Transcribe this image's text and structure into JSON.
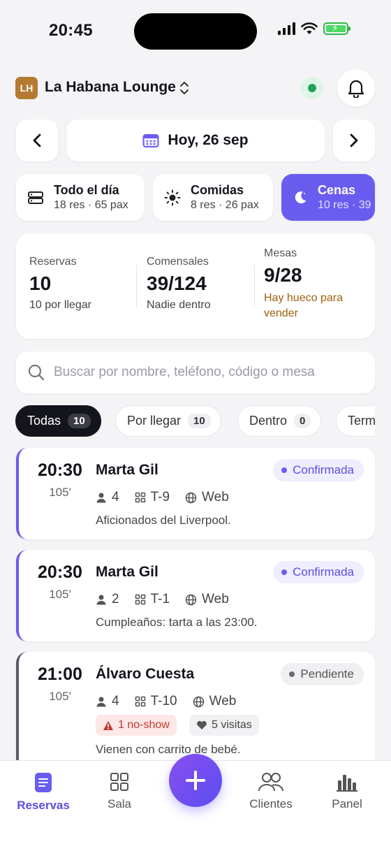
{
  "status_bar": {
    "time": "20:45"
  },
  "header": {
    "venue_initials": "LH",
    "venue_name": "La Habana Lounge"
  },
  "date_nav": {
    "label": "Hoy, 26 sep"
  },
  "services": [
    {
      "title": "Todo el día",
      "subtitle": "18 res · 65 pax",
      "icon": "list-icon"
    },
    {
      "title": "Comidas",
      "subtitle": "8 res · 26 pax",
      "icon": "sun-icon"
    },
    {
      "title": "Cenas",
      "subtitle": "10 res · 39",
      "icon": "moon-icon",
      "active": true
    }
  ],
  "stats": {
    "reservas": {
      "label": "Reservas",
      "value": "10",
      "sub": "10 por llegar"
    },
    "comensales": {
      "label": "Comensales",
      "value": "39/124",
      "sub": "Nadie dentro"
    },
    "mesas": {
      "label": "Mesas",
      "value": "9/28",
      "sub": "Hay hueco para vender"
    }
  },
  "search": {
    "placeholder": "Buscar por nombre, teléfono, código o mesa"
  },
  "filters": [
    {
      "label": "Todas",
      "count": "10",
      "active": true
    },
    {
      "label": "Por llegar",
      "count": "10"
    },
    {
      "label": "Dentro",
      "count": "0"
    },
    {
      "label": "Term"
    }
  ],
  "reservations": [
    {
      "time": "20:30",
      "duration": "105′",
      "name": "Marta Gil",
      "pax": "4",
      "table": "T-9",
      "source": "Web",
      "note": "Aficionados del Liverpool.",
      "status": "Confirmada"
    },
    {
      "time": "20:30",
      "duration": "105′",
      "name": "Marta Gil",
      "pax": "2",
      "table": "T-1",
      "source": "Web",
      "note": "Cumpleaños: tarta a las 23:00.",
      "status": "Confirmada"
    },
    {
      "time": "21:00",
      "duration": "105′",
      "name": "Álvaro Cuesta",
      "pax": "4",
      "table": "T-10",
      "source": "Web",
      "note": "Vienen con carrito de bebé.",
      "status": "Pendiente",
      "noshow_tag": "1 no-show",
      "visits_tag": "5 visitas"
    }
  ],
  "bottom_nav": {
    "reservas": "Reservas",
    "sala": "Sala",
    "clientes": "Clientes",
    "panel": "Panel"
  },
  "colors": {
    "accent": "#6b5cf0",
    "online": "#1fa35c",
    "warning_text": "#a0600c",
    "pending_border": "#5a5a66"
  }
}
